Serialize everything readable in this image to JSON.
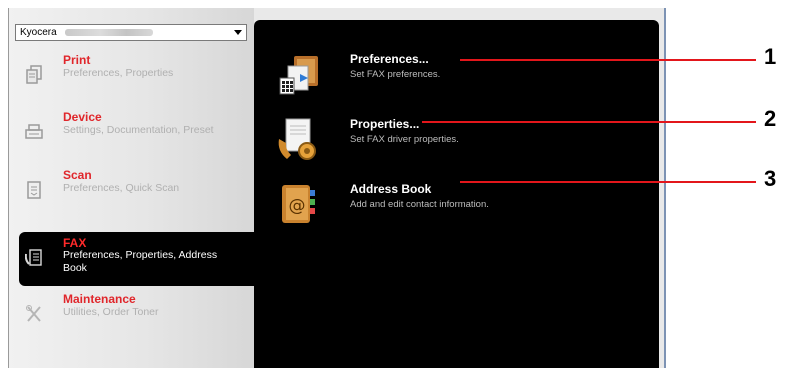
{
  "printer_select": {
    "value": "Kyocera"
  },
  "nav": [
    {
      "title": "Print",
      "subtitle": "Preferences, Properties"
    },
    {
      "title": "Device",
      "subtitle": "Settings, Documentation, Preset"
    },
    {
      "title": "Scan",
      "subtitle": "Preferences, Quick Scan"
    },
    {
      "title": "FAX",
      "subtitle": "Preferences, Properties, Address Book"
    },
    {
      "title": "Maintenance",
      "subtitle": "Utilities, Order Toner"
    }
  ],
  "fax_options": [
    {
      "title": "Preferences...",
      "description": "Set FAX preferences."
    },
    {
      "title": "Properties...",
      "description": "Set FAX driver properties."
    },
    {
      "title": "Address Book",
      "description": "Add and edit contact information."
    }
  ],
  "callouts": [
    "1",
    "2",
    "3"
  ],
  "colors": {
    "accent": "#e3161b",
    "panel": "#000000",
    "sidebar": "#e6e6e6"
  }
}
